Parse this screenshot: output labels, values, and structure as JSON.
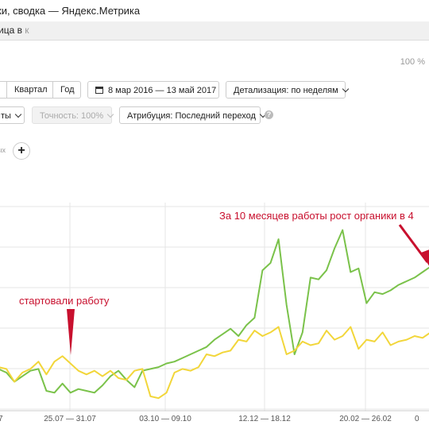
{
  "window": {
    "title": "ки, сводка — Яндекс.Метрика",
    "address_main": "ица в ",
    "address_faded": "к"
  },
  "zoom_label": "100 %",
  "toolbar": {
    "periods": [
      "",
      "Квартал",
      "Год"
    ],
    "date_range": "8 мар 2016 — 13 май 2017",
    "detail": "Детализация: по неделям",
    "visits_dropdown": "ты",
    "accuracy": "Точность: 100%",
    "attribution": "Атрибуция: Последний переход",
    "help": "?"
  },
  "segment": {
    "cut_label": "ых",
    "add": "+"
  },
  "annotations": {
    "start": "стартовали работу",
    "growth": "За 10 месяцев работы рост органики в 4"
  },
  "colors": {
    "green": "#7ac24a",
    "yellow": "#f2d63a",
    "red": "#c8102e",
    "grid": "#e6e6e6"
  },
  "chart_data": {
    "type": "line",
    "x_tick_labels": [
      "25.07 — 31.07",
      "03.10 — 09.10",
      "12.12 — 18.12",
      "20.02 — 26.02"
    ],
    "ylim": [
      0,
      100
    ],
    "grid": true,
    "series": [
      {
        "color": "#7ac24a",
        "values": [
          22,
          20,
          15,
          18,
          21,
          22,
          10,
          9,
          14,
          9,
          11,
          10,
          9,
          13,
          18,
          21,
          16,
          12,
          21,
          22,
          23,
          25,
          26,
          28,
          30,
          32,
          34,
          38,
          41,
          44,
          40,
          46,
          50,
          76,
          80,
          93,
          57,
          30,
          42,
          72,
          71,
          76,
          88,
          98,
          75,
          77,
          58,
          64,
          63,
          65,
          68,
          70,
          72,
          75,
          78
        ]
      },
      {
        "color": "#f2d63a",
        "values": [
          23,
          22,
          15,
          20,
          22,
          26,
          19,
          26,
          29,
          25,
          21,
          19,
          21,
          18,
          21,
          17,
          16,
          21,
          22,
          7,
          6,
          9,
          20,
          22,
          21,
          23,
          30,
          29,
          31,
          32,
          38,
          37,
          43,
          40,
          42,
          45,
          30,
          32,
          37,
          35,
          36,
          43,
          38,
          40,
          45,
          33,
          38,
          37,
          42,
          35,
          37,
          38,
          40,
          39,
          42
        ]
      }
    ]
  }
}
